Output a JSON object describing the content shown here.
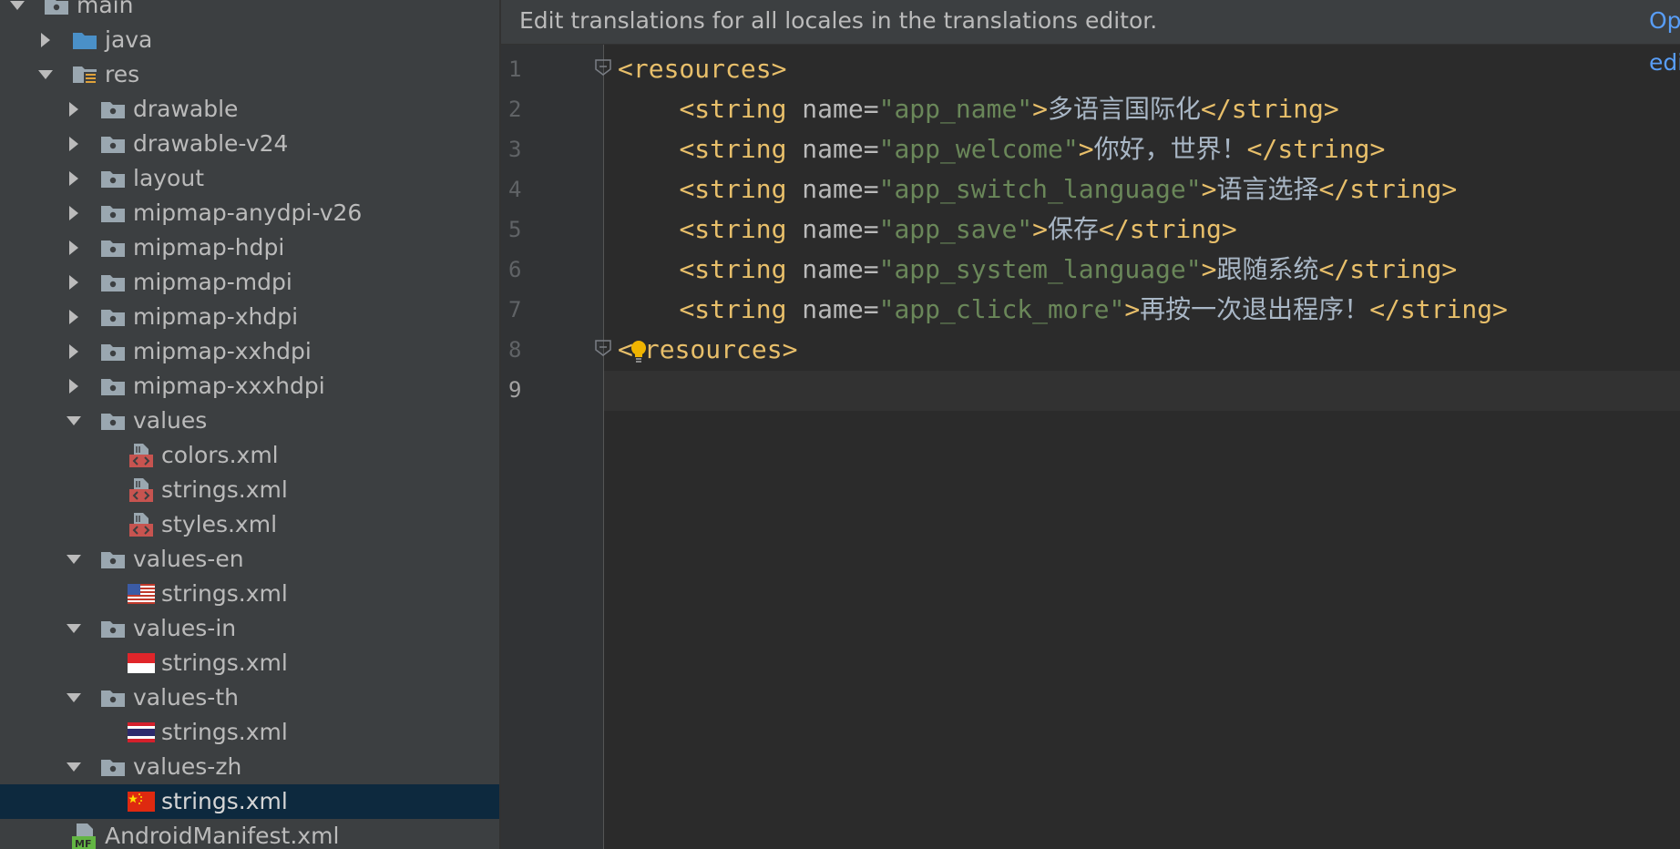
{
  "tree": {
    "rows": [
      {
        "label": "main",
        "depth": 0,
        "expand": "open",
        "icon": "folder-icon"
      },
      {
        "label": "java",
        "depth": 1,
        "expand": "closed",
        "icon": "blue-folder-icon"
      },
      {
        "label": "res",
        "depth": 1,
        "expand": "open",
        "icon": "resource-folder-icon"
      },
      {
        "label": "drawable",
        "depth": 2,
        "expand": "closed",
        "icon": "folder-icon"
      },
      {
        "label": "drawable-v24",
        "depth": 2,
        "expand": "closed",
        "icon": "folder-icon"
      },
      {
        "label": "layout",
        "depth": 2,
        "expand": "closed",
        "icon": "folder-icon"
      },
      {
        "label": "mipmap-anydpi-v26",
        "depth": 2,
        "expand": "closed",
        "icon": "folder-icon"
      },
      {
        "label": "mipmap-hdpi",
        "depth": 2,
        "expand": "closed",
        "icon": "folder-icon"
      },
      {
        "label": "mipmap-mdpi",
        "depth": 2,
        "expand": "closed",
        "icon": "folder-icon"
      },
      {
        "label": "mipmap-xhdpi",
        "depth": 2,
        "expand": "closed",
        "icon": "folder-icon"
      },
      {
        "label": "mipmap-xxhdpi",
        "depth": 2,
        "expand": "closed",
        "icon": "folder-icon"
      },
      {
        "label": "mipmap-xxxhdpi",
        "depth": 2,
        "expand": "closed",
        "icon": "folder-icon"
      },
      {
        "label": "values",
        "depth": 2,
        "expand": "open",
        "icon": "folder-icon"
      },
      {
        "label": "colors.xml",
        "depth": 3,
        "expand": "none",
        "icon": "xml-file-icon"
      },
      {
        "label": "strings.xml",
        "depth": 3,
        "expand": "none",
        "icon": "xml-file-icon"
      },
      {
        "label": "styles.xml",
        "depth": 3,
        "expand": "none",
        "icon": "xml-file-icon"
      },
      {
        "label": "values-en",
        "depth": 2,
        "expand": "open",
        "icon": "folder-icon"
      },
      {
        "label": "strings.xml",
        "depth": 3,
        "expand": "none",
        "icon": "us-flag-icon"
      },
      {
        "label": "values-in",
        "depth": 2,
        "expand": "open",
        "icon": "folder-icon"
      },
      {
        "label": "strings.xml",
        "depth": 3,
        "expand": "none",
        "icon": "indonesia-flag-icon"
      },
      {
        "label": "values-th",
        "depth": 2,
        "expand": "open",
        "icon": "folder-icon"
      },
      {
        "label": "strings.xml",
        "depth": 3,
        "expand": "none",
        "icon": "thailand-flag-icon"
      },
      {
        "label": "values-zh",
        "depth": 2,
        "expand": "open",
        "icon": "folder-icon"
      },
      {
        "label": "strings.xml",
        "depth": 3,
        "expand": "none",
        "icon": "china-flag-icon",
        "selected": true
      },
      {
        "label": "AndroidManifest.xml",
        "depth": 1,
        "expand": "none",
        "icon": "manifest-file-icon"
      }
    ]
  },
  "banner": {
    "text": "Edit translations for all locales in the translations editor.",
    "link": "Open editor"
  },
  "editor": {
    "current_line": 9,
    "lines": [
      {
        "n": "1",
        "tokens": [
          {
            "t": "tag",
            "v": "<resources>"
          }
        ]
      },
      {
        "n": "2",
        "tokens": [
          {
            "t": "txt",
            "v": "    "
          },
          {
            "t": "tag",
            "v": "<string "
          },
          {
            "t": "attr",
            "v": "name="
          },
          {
            "t": "val",
            "v": "\"app_name\""
          },
          {
            "t": "tag",
            "v": ">"
          },
          {
            "t": "txt",
            "v": "多语言国际化"
          },
          {
            "t": "tag",
            "v": "</string>"
          }
        ]
      },
      {
        "n": "3",
        "tokens": [
          {
            "t": "txt",
            "v": "    "
          },
          {
            "t": "tag",
            "v": "<string "
          },
          {
            "t": "attr",
            "v": "name="
          },
          {
            "t": "val",
            "v": "\"app_welcome\""
          },
          {
            "t": "tag",
            "v": ">"
          },
          {
            "t": "txt",
            "v": "你好，世界！"
          },
          {
            "t": "tag",
            "v": "</string>"
          }
        ]
      },
      {
        "n": "4",
        "tokens": [
          {
            "t": "txt",
            "v": "    "
          },
          {
            "t": "tag",
            "v": "<string "
          },
          {
            "t": "attr",
            "v": "name="
          },
          {
            "t": "val",
            "v": "\"app_switch_language\""
          },
          {
            "t": "tag",
            "v": ">"
          },
          {
            "t": "txt",
            "v": "语言选择"
          },
          {
            "t": "tag",
            "v": "</string>"
          }
        ]
      },
      {
        "n": "5",
        "tokens": [
          {
            "t": "txt",
            "v": "    "
          },
          {
            "t": "tag",
            "v": "<string "
          },
          {
            "t": "attr",
            "v": "name="
          },
          {
            "t": "val",
            "v": "\"app_save\""
          },
          {
            "t": "tag",
            "v": ">"
          },
          {
            "t": "txt",
            "v": "保存"
          },
          {
            "t": "tag",
            "v": "</string>"
          }
        ]
      },
      {
        "n": "6",
        "tokens": [
          {
            "t": "txt",
            "v": "    "
          },
          {
            "t": "tag",
            "v": "<string "
          },
          {
            "t": "attr",
            "v": "name="
          },
          {
            "t": "val",
            "v": "\"app_system_language\""
          },
          {
            "t": "tag",
            "v": ">"
          },
          {
            "t": "txt",
            "v": "跟随系统"
          },
          {
            "t": "tag",
            "v": "</string>"
          }
        ]
      },
      {
        "n": "7",
        "tokens": [
          {
            "t": "txt",
            "v": "    "
          },
          {
            "t": "tag",
            "v": "<string "
          },
          {
            "t": "attr",
            "v": "name="
          },
          {
            "t": "val",
            "v": "\"app_click_more\""
          },
          {
            "t": "tag",
            "v": ">"
          },
          {
            "t": "txt",
            "v": "再按一次退出程序！"
          },
          {
            "t": "tag",
            "v": "</string>"
          }
        ]
      },
      {
        "n": "8",
        "tokens": [
          {
            "t": "tag",
            "v": "<"
          },
          {
            "t": "bulb",
            "v": ""
          },
          {
            "t": "tag",
            "v": "resources>"
          }
        ]
      },
      {
        "n": "9",
        "tokens": []
      }
    ]
  },
  "colors": {
    "tree_bg": "#3c3f41",
    "editor_bg": "#2b2b2b",
    "selection": "#0d293e",
    "tag": "#e8bf6a",
    "attr_value": "#6a8759",
    "text": "#a9b7c6",
    "link": "#589df6"
  }
}
